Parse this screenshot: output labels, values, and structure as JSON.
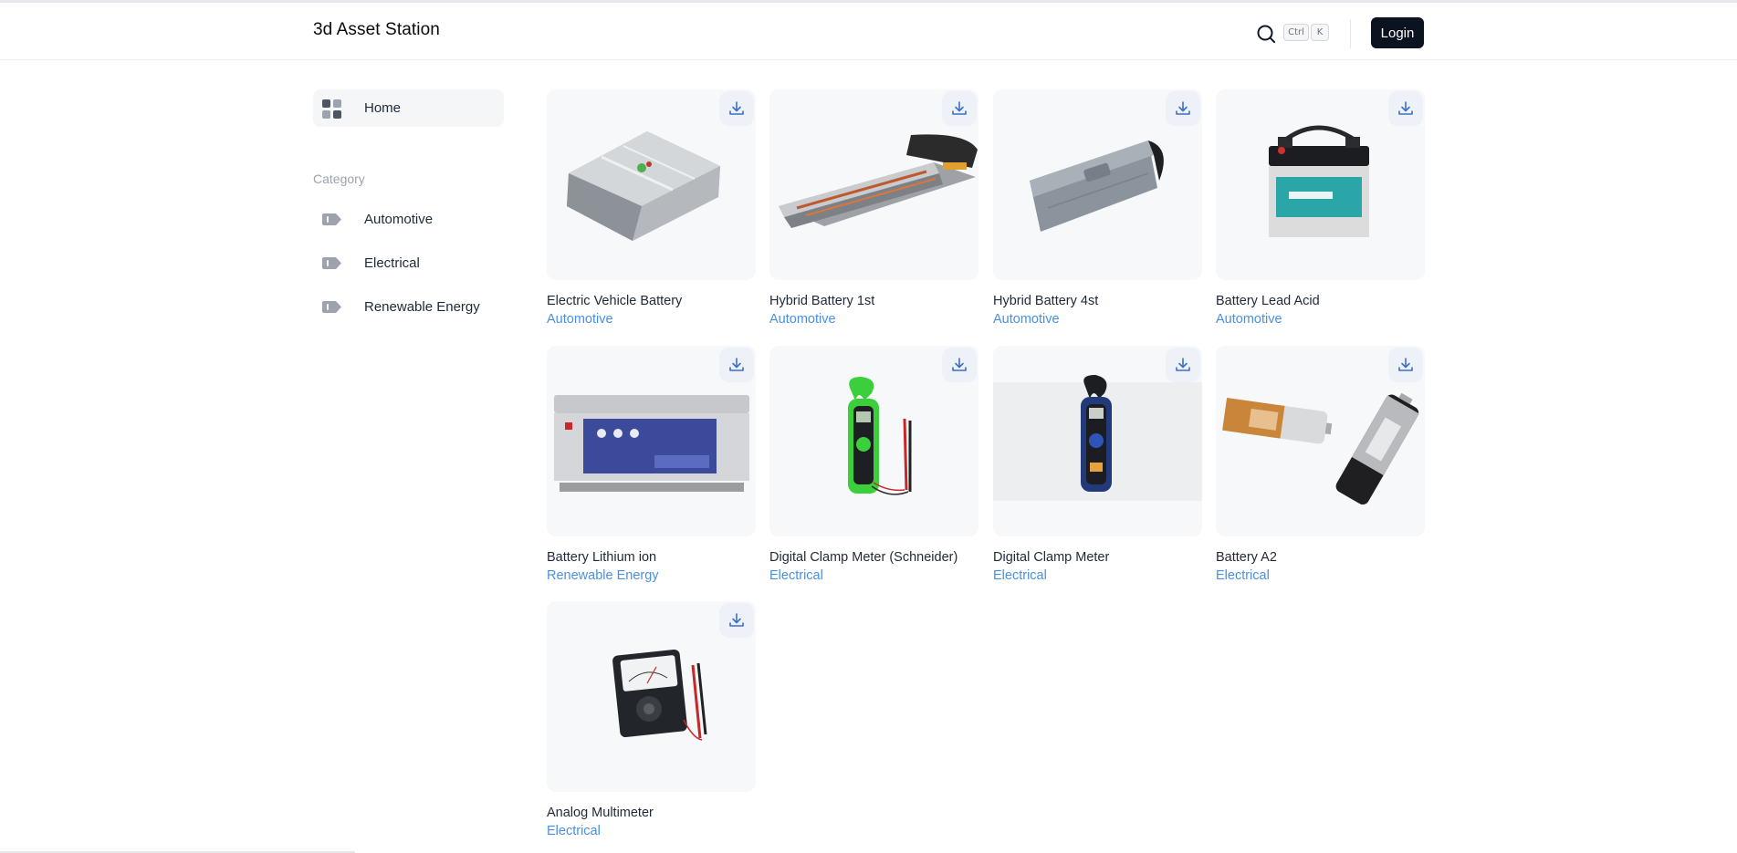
{
  "app": {
    "title": "3d Asset Station"
  },
  "header": {
    "search_icon": "search-icon",
    "shortcut_keys": [
      "Ctrl",
      "K"
    ],
    "login_label": "Login"
  },
  "sidebar": {
    "home_label": "Home",
    "category_heading": "Category",
    "categories": [
      {
        "label": "Automotive",
        "icon": "tag-icon"
      },
      {
        "label": "Electrical",
        "icon": "tag-icon"
      },
      {
        "label": "Renewable Energy",
        "icon": "tag-icon"
      }
    ]
  },
  "assets": [
    {
      "title": "Electric Vehicle Battery",
      "category": "Automotive"
    },
    {
      "title": "Hybrid Battery 1st",
      "category": "Automotive"
    },
    {
      "title": "Hybrid Battery 4st",
      "category": "Automotive"
    },
    {
      "title": "Battery Lead Acid",
      "category": "Automotive"
    },
    {
      "title": "Battery Lithium ion",
      "category": "Renewable Energy"
    },
    {
      "title": "Digital Clamp Meter (Schneider)",
      "category": "Electrical"
    },
    {
      "title": "Digital Clamp Meter",
      "category": "Electrical"
    },
    {
      "title": "Battery A2",
      "category": "Electrical"
    },
    {
      "title": "Analog Multimeter",
      "category": "Electrical"
    }
  ],
  "colors": {
    "accent_link": "#4a90e2",
    "login_bg": "#0b1220",
    "card_bg": "#f7f8fa",
    "download_btn_bg": "#eef2f8"
  }
}
